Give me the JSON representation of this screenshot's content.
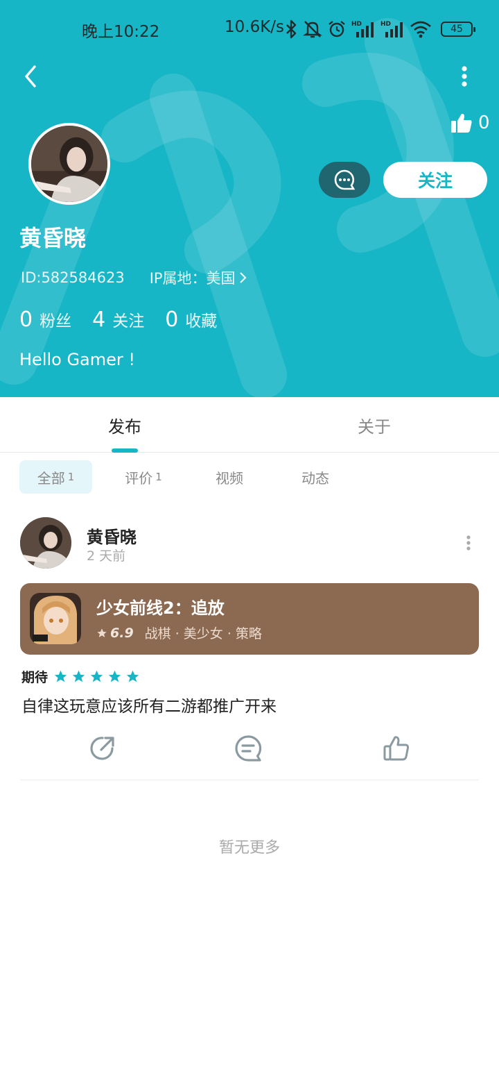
{
  "status_bar": {
    "time": "晚上10:22",
    "network_speed": "10.6K/s",
    "battery": "45",
    "icons": [
      "bluetooth-icon",
      "mute-bell-icon",
      "alarm-icon",
      "signal-hd-icon",
      "signal-hd-icon",
      "wifi-icon",
      "battery-icon"
    ]
  },
  "colors": {
    "header_bg": "#17b6c6",
    "accent": "#17b6c6",
    "game_card_bg": "#8c6a52",
    "message_button_bg": "#1f6670"
  },
  "profile": {
    "likes": "0",
    "name": "黄昏晓",
    "id_text": "ID:582584623",
    "ip_text": "IP属地：美国",
    "follow_label": "关注",
    "stats": [
      {
        "num": "0",
        "label": "粉丝"
      },
      {
        "num": "4",
        "label": "关注"
      },
      {
        "num": "0",
        "label": "收藏"
      }
    ],
    "bio": "Hello Gamer !"
  },
  "tabs": [
    {
      "label": "发布",
      "active": true
    },
    {
      "label": "关于",
      "active": false
    }
  ],
  "filters": [
    {
      "label": "全部",
      "count": "1",
      "active": true
    },
    {
      "label": "评价",
      "count": "1",
      "active": false
    },
    {
      "label": "视频",
      "count": "",
      "active": false
    },
    {
      "label": "动态",
      "count": "",
      "active": false
    }
  ],
  "post": {
    "author": "黄昏晓",
    "time": "2 天前",
    "game": {
      "title": "少女前线2：追放",
      "rating": "6.9",
      "tags": "战棋 · 美少女 · 策略"
    },
    "expect_label": "期待",
    "stars": 5,
    "text": "自律这玩意应该所有二游都推广开来"
  },
  "footer_text": "暂无更多"
}
